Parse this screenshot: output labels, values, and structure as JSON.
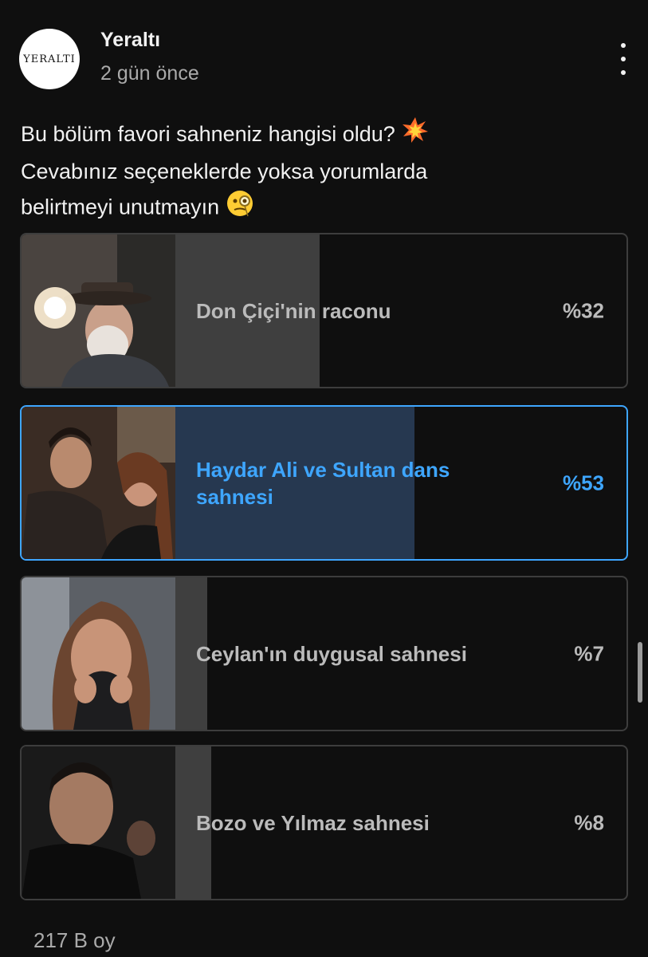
{
  "channel": {
    "name": "Yeraltı",
    "time_ago": "2 gün önce",
    "avatar_text": "YERALTI"
  },
  "post": {
    "text_lines": [
      "Bu bölüm favori sahneniz hangisi oldu?",
      "Cevabınız seçeneklerde yoksa yorumlarda",
      "belirtmeyi unutmayın"
    ],
    "emojis": [
      "collision-emoji",
      "monocle-face-emoji"
    ]
  },
  "poll": {
    "options": [
      {
        "label": "Don Çiçi'nin raconu",
        "percent_text": "%32",
        "percent": 32,
        "selected": false,
        "thumb_icon": "man-with-hat-firing-gun-thumbnail"
      },
      {
        "label": "Haydar Ali ve Sultan dans sahnesi",
        "percent_text": "%53",
        "percent": 53,
        "selected": true,
        "thumb_icon": "couple-dancing-thumbnail"
      },
      {
        "label": "Ceylan'ın duygusal sahnesi",
        "percent_text": "%7",
        "percent": 7,
        "selected": false,
        "thumb_icon": "woman-crying-thumbnail"
      },
      {
        "label": "Bozo ve Yılmaz sahnesi",
        "percent_text": "%8",
        "percent": 8,
        "selected": false,
        "thumb_icon": "man-portrait-thumbnail"
      }
    ],
    "votes": "217 B oy"
  },
  "colors": {
    "background": "#0f0f0f",
    "accent": "#3ea6ff",
    "selected_fill": "#263850",
    "bar_fill": "#3f3f3f"
  }
}
